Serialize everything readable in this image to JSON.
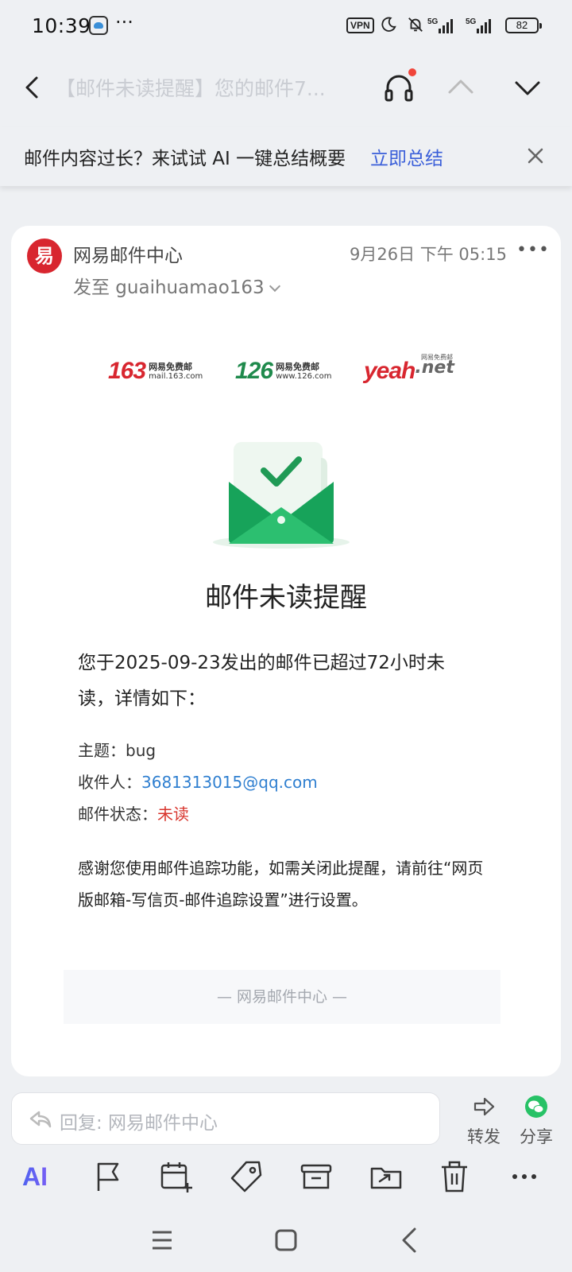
{
  "status_bar": {
    "time": "10:39",
    "dots": "···",
    "vpn": "VPN",
    "battery": "82",
    "signal_1": "5G",
    "signal_2": "5G"
  },
  "header": {
    "title": "【邮件未读提醒】您的邮件7...",
    "icons": [
      "back-arrow-icon",
      "headset-icon",
      "chevron-up-icon",
      "chevron-down-icon"
    ]
  },
  "ai_banner": {
    "text": "邮件内容过长？来试试 AI 一键总结概要",
    "link": "立即总结"
  },
  "email": {
    "sender": "网易邮件中心",
    "avatar_char": "易",
    "date": "9月26日 下午 05:15",
    "to_label": "发至 guaihuamao163",
    "logos": {
      "l163": "163",
      "l163_cn": "网易免费邮",
      "l163_url": "mail.163.com",
      "l126": "126",
      "l126_cn": "网易免费邮",
      "l126_url": "www.126.com",
      "yeah": "yeah",
      "yeah_net": ".net",
      "yeah_cn": "网易免费邮"
    },
    "title": "邮件未读提醒",
    "intro": "您于2025-09-23发出的邮件已超过72小时未读，详情如下：",
    "subject_label": "主题：",
    "subject_value": "bug",
    "recipient_label": "收件人：",
    "recipient_value": "3681313015@qq.com",
    "status_label": "邮件状态：",
    "status_value": "未读",
    "thanks": "感谢您使用邮件追踪功能，如需关闭此提醒，请前往“网页版邮箱-写信页-邮件追踪设置”进行设置。",
    "footer": "— 网易邮件中心 —"
  },
  "reply_bar": {
    "placeholder": "回复: 网易邮件中心",
    "forward": "转发",
    "share": "分享"
  },
  "toolbar": {
    "ai": "AI",
    "icons": [
      "ai-icon",
      "flag-icon",
      "calendar-add-icon",
      "tag-icon",
      "archive-icon",
      "move-folder-icon",
      "trash-icon",
      "more-icon"
    ]
  },
  "colors": {
    "accent": "#3b5fd9",
    "brand_red": "#d8262f",
    "green": "#1f8a4c",
    "link_blue": "#2f7fd0",
    "status_red": "#d8362e"
  }
}
